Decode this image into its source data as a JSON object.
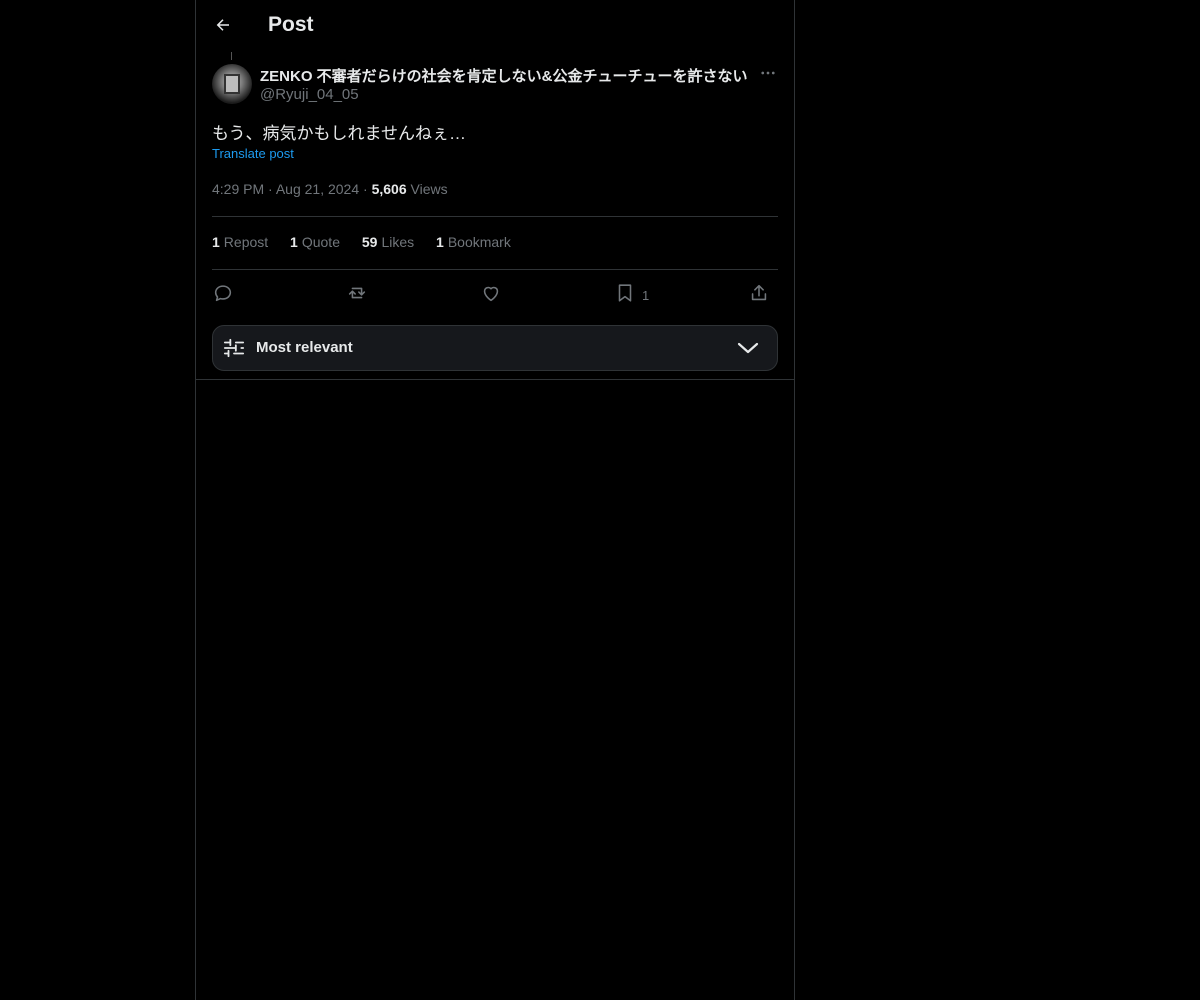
{
  "header": {
    "title": "Post"
  },
  "post": {
    "display_name": "ZENKO 不審者だらけの社会を肯定しない&公金チューチューを許さない",
    "handle": "@Ryuji_04_05",
    "text": "もう、病気かもしれませんねぇ…",
    "translate_label": "Translate post",
    "time": "4:29 PM",
    "date": "Aug 21, 2024",
    "views_count": "5,606",
    "views_label": "Views",
    "separator": "·"
  },
  "stats": {
    "reposts_count": "1",
    "reposts_label": "Repost",
    "quotes_count": "1",
    "quotes_label": "Quote",
    "likes_count": "59",
    "likes_label": "Likes",
    "bookmarks_count": "1",
    "bookmarks_label": "Bookmark"
  },
  "actions": {
    "bookmark_count": "1"
  },
  "sort": {
    "label": "Most relevant"
  },
  "icons": {
    "back": "arrow-left-icon",
    "more": "more-icon",
    "reply": "reply-icon",
    "repost": "repost-icon",
    "like": "heart-icon",
    "bookmark": "bookmark-icon",
    "share": "share-icon",
    "sort": "sliders-icon",
    "chevron": "chevron-down-icon"
  },
  "colors": {
    "background": "#000000",
    "text_primary": "#e7e9ea",
    "text_secondary": "#71767b",
    "link": "#1d9bf0",
    "border": "#2f3336"
  }
}
